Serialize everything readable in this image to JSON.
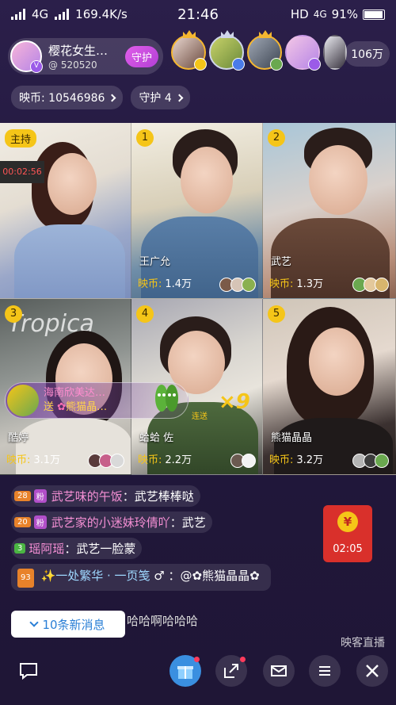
{
  "status_bar": {
    "network": "4G",
    "speed": "169.4K/s",
    "time": "21:46",
    "hd_label": "HD",
    "network_right": "4G",
    "battery": "91%"
  },
  "host": {
    "name": "樱花女生…",
    "id": "@ 520520",
    "guard_button": "守护"
  },
  "viewer_count": "106万",
  "coin_bar": {
    "coins_label": "映币: 10546986",
    "guard_label": "守护 4"
  },
  "tiles": [
    {
      "tag": "主持",
      "name": "",
      "coins_label": "",
      "coins_value": ""
    },
    {
      "tag": "1",
      "name": "王广允",
      "coins_label": "映币:",
      "coins_value": "1.4万"
    },
    {
      "tag": "2",
      "name": "武艺",
      "coins_label": "映币:",
      "coins_value": "1.3万"
    },
    {
      "tag": "3",
      "name": "酷婷",
      "coins_label": "映币:",
      "coins_value": "3.1万"
    },
    {
      "tag": "4",
      "name": "蛤蛤 佐",
      "coins_label": "映币:",
      "coins_value": "2.2万"
    },
    {
      "tag": "5",
      "name": "熊猫晶晶",
      "coins_label": "映币:",
      "coins_value": "3.2万"
    }
  ],
  "gift_banner": {
    "user": "海南欣美达…",
    "action": "送",
    "target": "熊猫晶…",
    "combo": "×9",
    "combo_label": "连送"
  },
  "chat": [
    {
      "level": "28",
      "badge": "粉",
      "user": "武艺味的午饭",
      "text": "：武艺棒棒哒"
    },
    {
      "level": "20",
      "badge": "粉",
      "user": "武艺家的小迷妹玲倩吖",
      "text": "：武艺"
    },
    {
      "level": "3",
      "badge": "",
      "user": "瑶阿瑶",
      "text": "：武艺一脸蒙"
    },
    {
      "level": "93",
      "badge": "",
      "user": "✨一处繁华 · 一页笺",
      "text": " ♂ ：@✿熊猫晶晶✿"
    }
  ],
  "new_messages": "10条新消息",
  "tail_message": "哈哈啊哈哈哈",
  "red_packet": {
    "symbol": "¥",
    "countdown": "02:05"
  },
  "brand": "映客直播",
  "colors": {
    "accent_yellow": "#f5c518",
    "accent_purple": "#b33fd6",
    "red_packet": "#d9302b"
  }
}
